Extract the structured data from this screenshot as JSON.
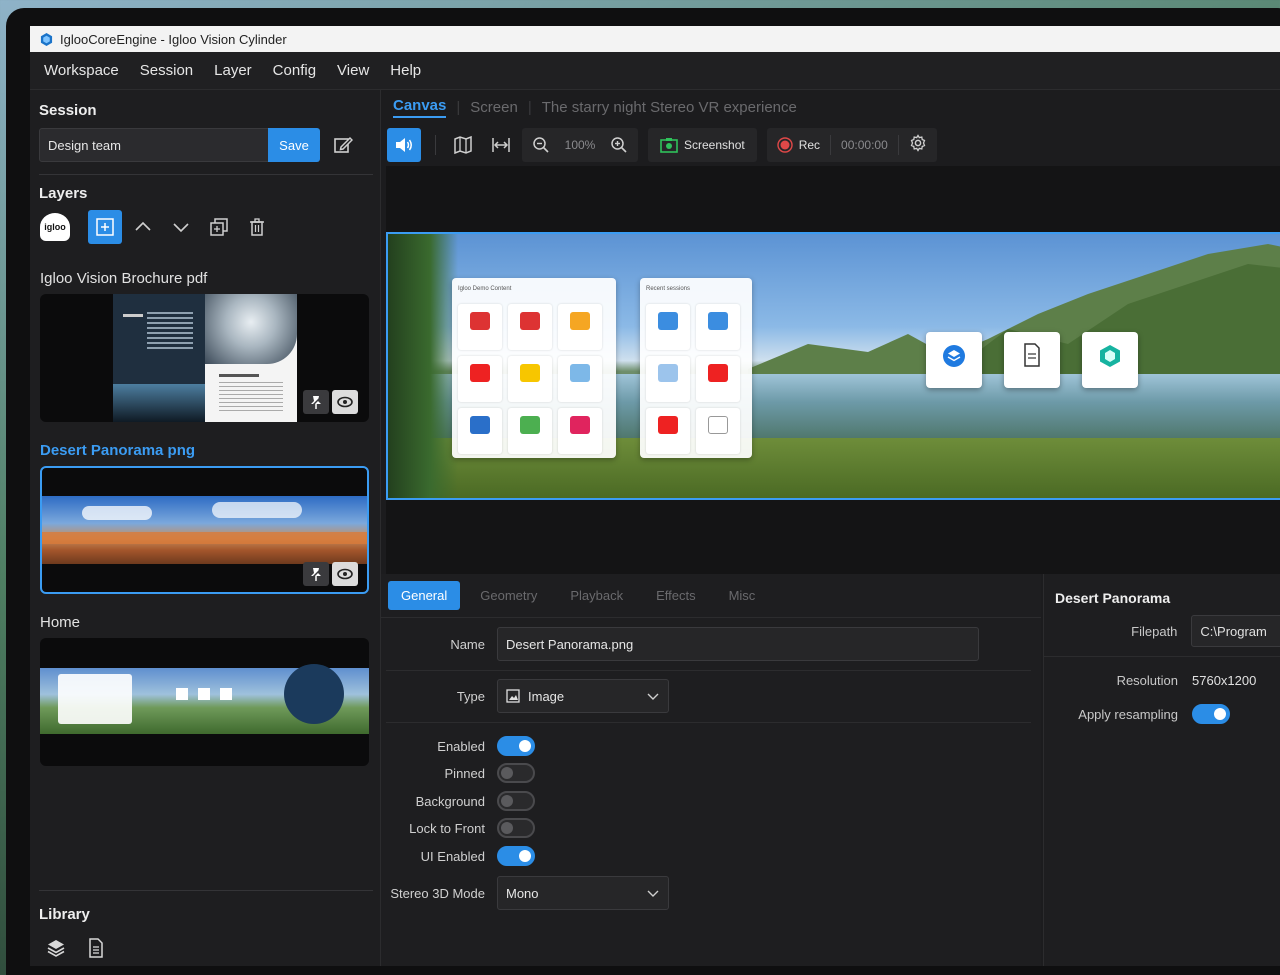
{
  "window": {
    "title": "IglooCoreEngine - Igloo Vision Cylinder"
  },
  "menu": [
    "Workspace",
    "Session",
    "Layer",
    "Config",
    "View",
    "Help"
  ],
  "sidebar": {
    "session_title": "Session",
    "session_name": "Design team",
    "save_label": "Save",
    "layers_title": "Layers",
    "igloo_logo_text": "igloo",
    "layers": [
      {
        "label": "Igloo Vision Brochure pdf",
        "active": false
      },
      {
        "label": "Desert Panorama png",
        "active": true
      },
      {
        "label": "Home",
        "active": false
      }
    ],
    "library_title": "Library"
  },
  "main": {
    "view_tabs": [
      {
        "label": "Canvas",
        "active": true
      },
      {
        "label": "Screen",
        "active": false
      },
      {
        "label": "The starry night Stereo VR experience",
        "active": false
      }
    ],
    "toolbar": {
      "zoom": "100%",
      "screenshot_label": "Screenshot",
      "rec_label": "Rec",
      "timer": "00:00:00"
    },
    "canvas": {
      "demo_card_title": "Igloo Demo Content",
      "recent_card_title": "Recent sessions"
    }
  },
  "properties": {
    "tabs": [
      {
        "label": "General",
        "active": true
      },
      {
        "label": "Geometry",
        "active": false
      },
      {
        "label": "Playback",
        "active": false
      },
      {
        "label": "Effects",
        "active": false
      },
      {
        "label": "Misc",
        "active": false
      }
    ],
    "name_label": "Name",
    "name_value": "Desert Panorama.png",
    "type_label": "Type",
    "type_value": "Image",
    "toggles": [
      {
        "label": "Enabled",
        "on": true
      },
      {
        "label": "Pinned",
        "on": false
      },
      {
        "label": "Background",
        "on": false
      },
      {
        "label": "Lock to Front",
        "on": false
      },
      {
        "label": "UI Enabled",
        "on": true
      }
    ],
    "stereo_label": "Stereo 3D Mode",
    "stereo_value": "Mono"
  },
  "details": {
    "title": "Desert Panorama",
    "filepath_label": "Filepath",
    "filepath_value": "C:\\Program",
    "resolution_label": "Resolution",
    "resolution_value": "5760x1200",
    "resampling_label": "Apply resampling",
    "resampling_on": true
  },
  "colors": {
    "accent": "#2b8de6",
    "active_text": "#3b9cf3",
    "background": "#1c1c1e"
  }
}
